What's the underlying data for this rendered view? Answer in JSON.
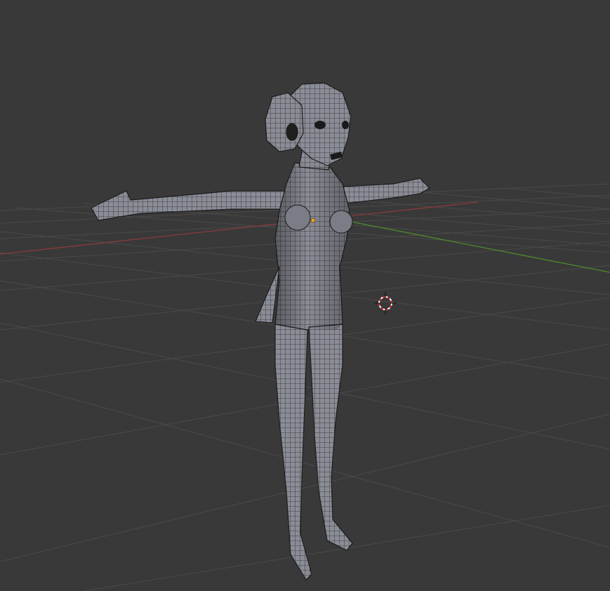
{
  "viewport": {
    "background_color": "#393939",
    "grid_color": "#4a4a4a",
    "x_axis_color": "#8a3a3a",
    "y_axis_color": "#4f8a2a",
    "mesh_fill_color": "#8a8c96",
    "mesh_wire_color": "#1c1c1c",
    "cursor_icon": "3d-cursor-icon",
    "origin_icon": "object-origin-icon",
    "origin_color": "#f0a030"
  }
}
